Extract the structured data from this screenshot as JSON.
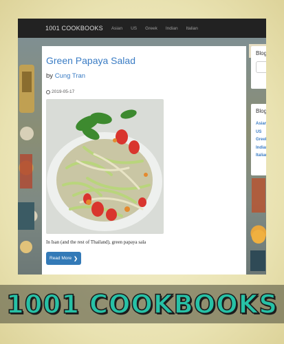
{
  "navbar": {
    "brand": "1001 COOKBOOKS",
    "links": [
      "Asian",
      "US",
      "Greek",
      "Indian",
      "Italian"
    ]
  },
  "post": {
    "title": "Green Papaya Salad",
    "by_label": "by",
    "author": "Cung Tran",
    "date": "2019-05-17",
    "excerpt": "In Isan (and the rest of Thailand), green papaya sala",
    "read_more": "Read More",
    "read_more_icon": "chevron-right-icon",
    "date_icon": "clock-icon"
  },
  "sidebar": {
    "search_title": "Blog",
    "categories_title": "Blog",
    "categories": [
      "Asian",
      "US",
      "Greek",
      "Indian",
      "Italian"
    ]
  },
  "banner": {
    "text": "1001 COOKBOOKS"
  },
  "colors": {
    "link": "#3a7cc4",
    "navbar": "#222222",
    "button": "#337ab7",
    "banner_text": "#27c1a6"
  }
}
